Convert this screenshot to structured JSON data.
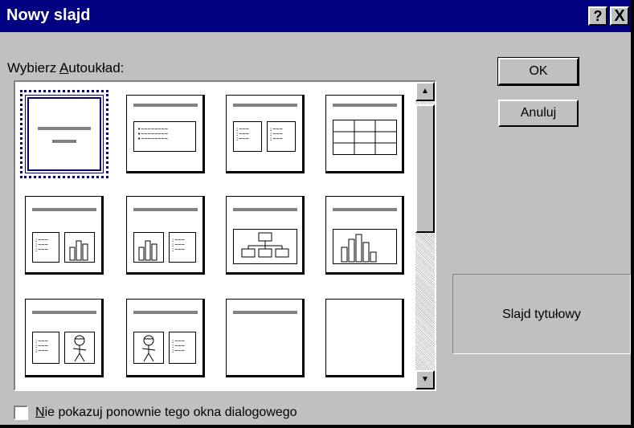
{
  "window": {
    "title": "Nowy slajd",
    "help_glyph": "?",
    "close_glyph": "X"
  },
  "layout_label": {
    "before": "Wybierz ",
    "underlined": "A",
    "after": "utoukład:"
  },
  "layouts": [
    {
      "name": "title-slide",
      "selected": true
    },
    {
      "name": "bulleted-list"
    },
    {
      "name": "two-column-text"
    },
    {
      "name": "table"
    },
    {
      "name": "text-and-chart"
    },
    {
      "name": "chart-and-text"
    },
    {
      "name": "organization-chart"
    },
    {
      "name": "chart"
    },
    {
      "name": "text-and-clip-art"
    },
    {
      "name": "clip-art-and-text"
    },
    {
      "name": "title-only"
    },
    {
      "name": "blank"
    }
  ],
  "buttons": {
    "ok": "OK",
    "cancel": "Anuluj"
  },
  "preview_text": "Slajd tytułowy",
  "checkbox": {
    "checked": false,
    "underlined": "N",
    "rest": "ie pokazuj ponownie tego okna dialogowego"
  },
  "colors": {
    "titlebar": "#000080",
    "dialog": "#c0c0c0",
    "selection": "#000080"
  }
}
